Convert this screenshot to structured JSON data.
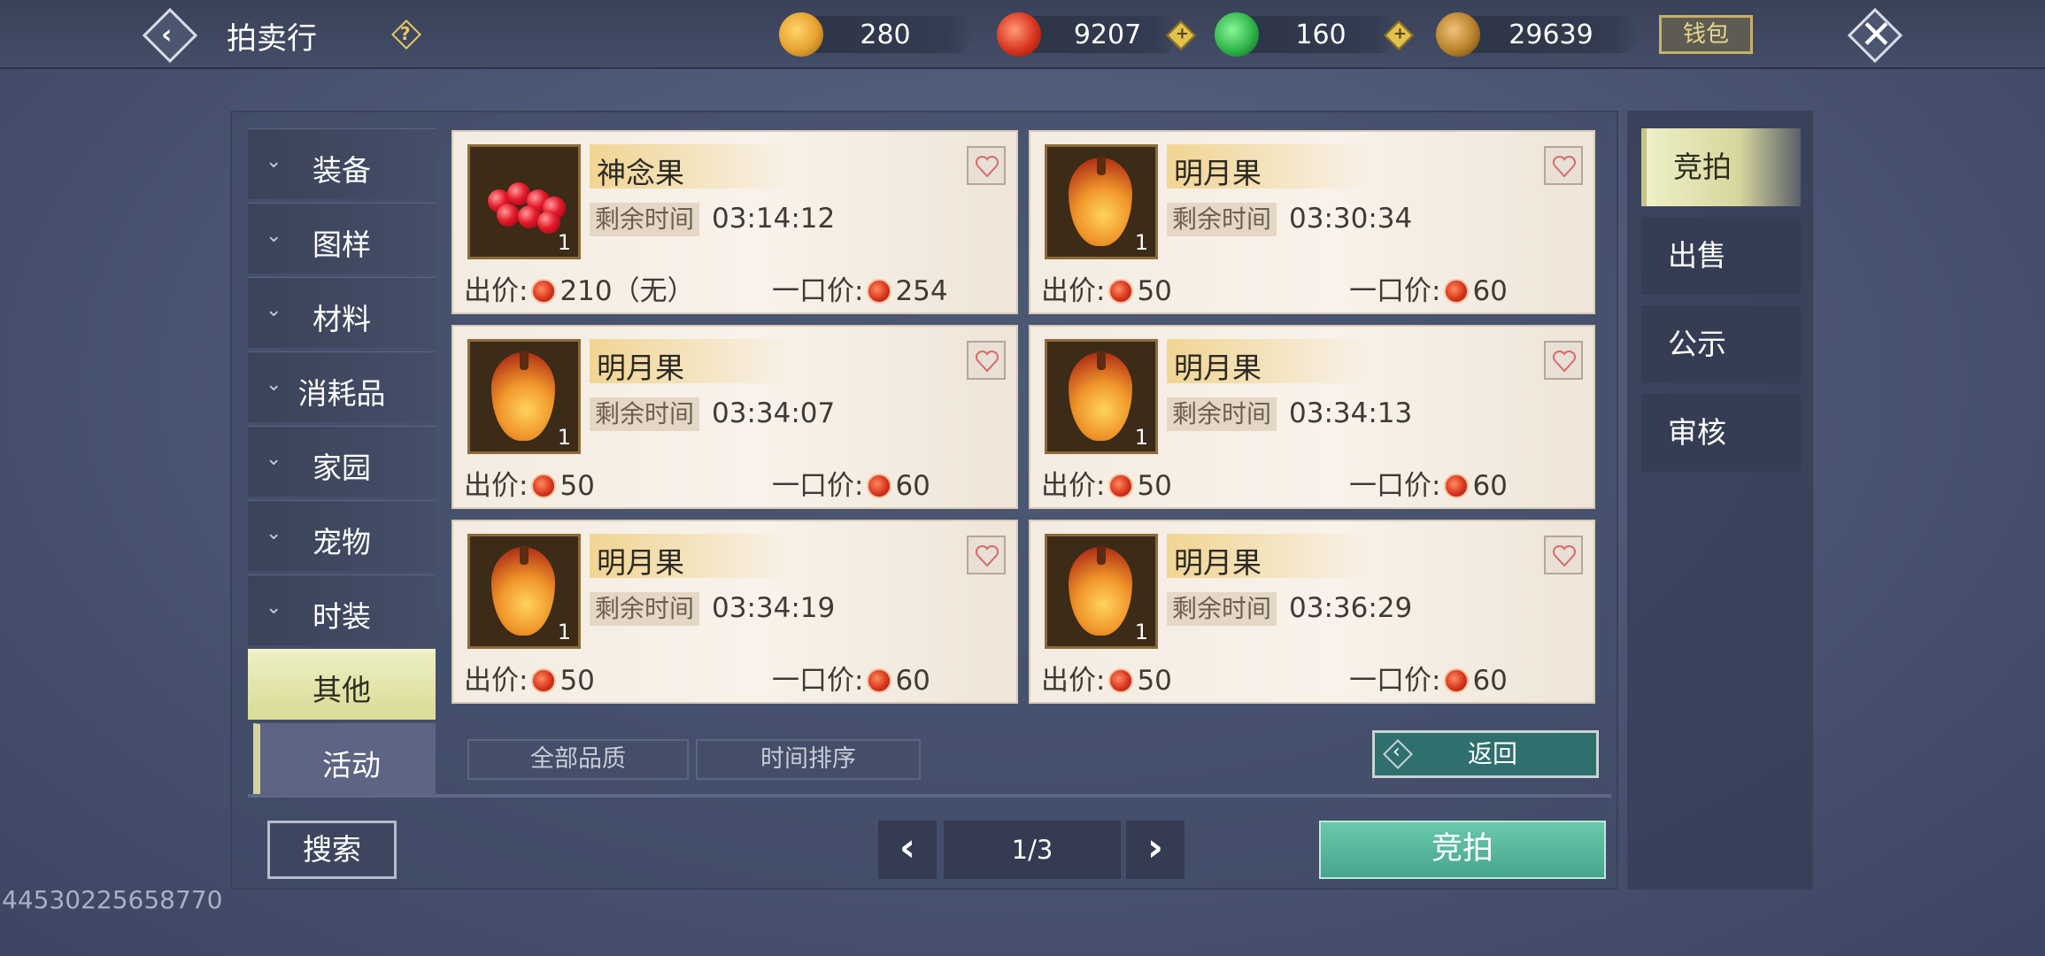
{
  "header": {
    "title": "拍卖行",
    "wallet_label": "钱包",
    "currencies": [
      {
        "name": "gold-token",
        "value": "280",
        "color": "#e6a12f"
      },
      {
        "name": "red-coin",
        "value": "9207",
        "color": "#d8351e"
      },
      {
        "name": "jade",
        "value": "160",
        "color": "#2fb64a"
      },
      {
        "name": "bronze-coin",
        "value": "29639",
        "color": "#b8822b"
      }
    ]
  },
  "sidebar": {
    "items": [
      {
        "label": "装备"
      },
      {
        "label": "图样"
      },
      {
        "label": "材料"
      },
      {
        "label": "消耗品"
      },
      {
        "label": "家园"
      },
      {
        "label": "宠物"
      },
      {
        "label": "时装"
      },
      {
        "label": "其他"
      },
      {
        "label": "活动"
      }
    ],
    "active": "其他"
  },
  "listing": {
    "time_label": "剩余时间",
    "bid_label": "出价:",
    "buyout_label": "一口价:",
    "items": [
      {
        "name": "神念果",
        "qty": "1",
        "time": "03:14:12",
        "bid": "210（无）",
        "buyout": "254",
        "icon": "red-berries"
      },
      {
        "name": "明月果",
        "qty": "1",
        "time": "03:30:34",
        "bid": "50",
        "buyout": "60",
        "icon": "moon-fruit"
      },
      {
        "name": "明月果",
        "qty": "1",
        "time": "03:34:07",
        "bid": "50",
        "buyout": "60",
        "icon": "moon-fruit"
      },
      {
        "name": "明月果",
        "qty": "1",
        "time": "03:34:13",
        "bid": "50",
        "buyout": "60",
        "icon": "moon-fruit"
      },
      {
        "name": "明月果",
        "qty": "1",
        "time": "03:34:19",
        "bid": "50",
        "buyout": "60",
        "icon": "moon-fruit"
      },
      {
        "name": "明月果",
        "qty": "1",
        "time": "03:36:29",
        "bid": "50",
        "buyout": "60",
        "icon": "moon-fruit"
      }
    ]
  },
  "filters": {
    "quality": "全部品质",
    "sort": "时间排序",
    "return": "返回"
  },
  "footer": {
    "search": "搜索",
    "page": "1/3",
    "auction": "竞拍"
  },
  "right_tabs": [
    {
      "label": "竞拍"
    },
    {
      "label": "出售"
    },
    {
      "label": "公示"
    },
    {
      "label": "审核"
    }
  ],
  "uid": "44530225658770"
}
